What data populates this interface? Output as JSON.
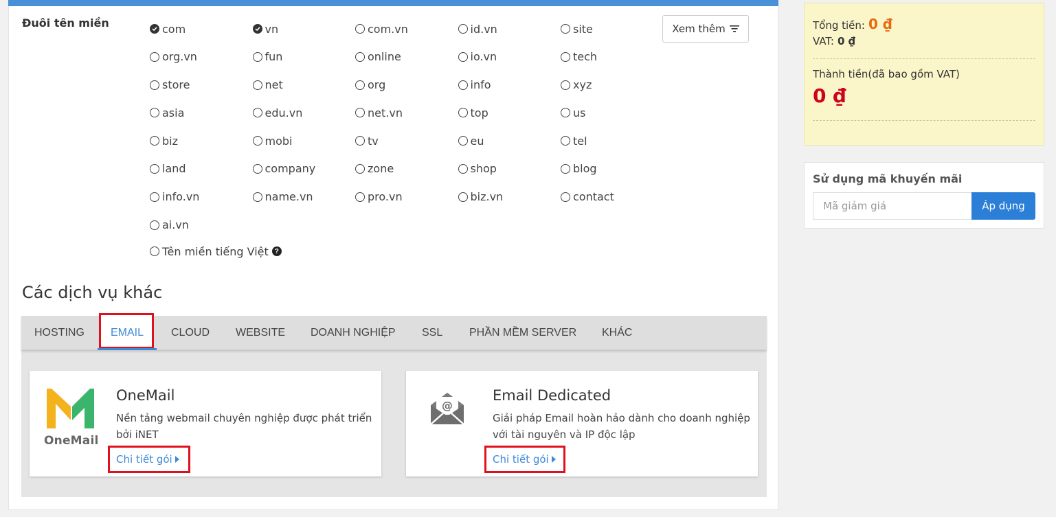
{
  "domain_section": {
    "label": "Đuôi tên miền",
    "extensions": [
      {
        "name": "com",
        "checked": true
      },
      {
        "name": "vn",
        "checked": true
      },
      {
        "name": "com.vn",
        "checked": false
      },
      {
        "name": "id.vn",
        "checked": false
      },
      {
        "name": "site",
        "checked": false
      },
      {
        "name": "org.vn",
        "checked": false
      },
      {
        "name": "fun",
        "checked": false
      },
      {
        "name": "online",
        "checked": false
      },
      {
        "name": "io.vn",
        "checked": false
      },
      {
        "name": "tech",
        "checked": false
      },
      {
        "name": "store",
        "checked": false
      },
      {
        "name": "net",
        "checked": false
      },
      {
        "name": "org",
        "checked": false
      },
      {
        "name": "info",
        "checked": false
      },
      {
        "name": "xyz",
        "checked": false
      },
      {
        "name": "asia",
        "checked": false
      },
      {
        "name": "edu.vn",
        "checked": false
      },
      {
        "name": "net.vn",
        "checked": false
      },
      {
        "name": "top",
        "checked": false
      },
      {
        "name": "us",
        "checked": false
      },
      {
        "name": "biz",
        "checked": false
      },
      {
        "name": "mobi",
        "checked": false
      },
      {
        "name": "tv",
        "checked": false
      },
      {
        "name": "eu",
        "checked": false
      },
      {
        "name": "tel",
        "checked": false
      },
      {
        "name": "land",
        "checked": false
      },
      {
        "name": "company",
        "checked": false
      },
      {
        "name": "zone",
        "checked": false
      },
      {
        "name": "shop",
        "checked": false
      },
      {
        "name": "blog",
        "checked": false
      },
      {
        "name": "info.vn",
        "checked": false
      },
      {
        "name": "name.vn",
        "checked": false
      },
      {
        "name": "pro.vn",
        "checked": false
      },
      {
        "name": "biz.vn",
        "checked": false
      },
      {
        "name": "contact",
        "checked": false
      },
      {
        "name": "ai.vn",
        "checked": false
      }
    ],
    "vietnamese_domain": "Tên miền tiếng Việt",
    "help_icon": "question-circle-icon",
    "more_button": "Xem thêm",
    "more_icon": "filter-lines-icon"
  },
  "services": {
    "title": "Các dịch vụ khác",
    "tabs": [
      "HOSTING",
      "EMAIL",
      "CLOUD",
      "WEBSITE",
      "DOANH NGHIỆP",
      "SSL",
      "PHẦN MỀM SERVER",
      "KHÁC"
    ],
    "active_tab": "EMAIL",
    "cards": [
      {
        "title": "OneMail",
        "desc_line1": "Nền tảng webmail chuyên nghiệp được phát triển",
        "desc_line2": "bởi iNET",
        "logo_text": "OneMail",
        "link": "Chi tiết gói"
      },
      {
        "title": "Email Dedicated",
        "desc_line1": "Giải pháp Email hoàn hảo dành cho doanh nghiệp",
        "desc_line2": "với tài nguyên và IP độc lập",
        "icon": "envelope-at-icon",
        "link": "Chi tiết gói"
      }
    ]
  },
  "summary": {
    "total_label": "Tổng tiền:",
    "total_value": "0 ₫",
    "vat_label": "VAT:",
    "vat_value": "0 ₫",
    "grand_label": "Thành tiền(đã bao gồm VAT)",
    "grand_value": "0 ₫"
  },
  "promo": {
    "title": "Sử dụng mã khuyến mãi",
    "placeholder": "Mã giảm giá",
    "button": "Áp dụng"
  },
  "colors": {
    "accent_blue": "#3c8ad8",
    "highlight_red": "#e0101c",
    "price_red": "#d0021b",
    "price_orange": "#e86a10",
    "summary_bg": "#fbf6c9"
  }
}
